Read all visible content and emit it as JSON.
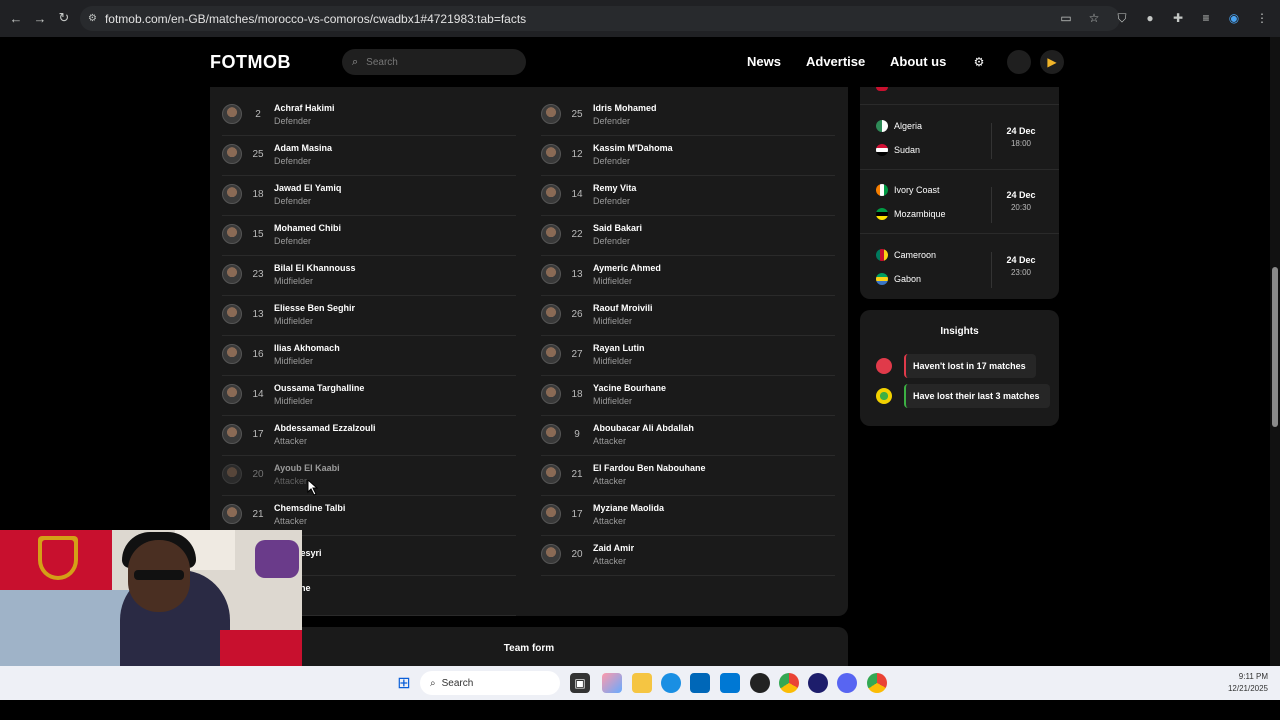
{
  "browser": {
    "url": "fotmob.com/en-GB/matches/morocco-vs-comoros/cwadbx1#4721983:tab=facts"
  },
  "header": {
    "logo": "FOTMOB",
    "search_placeholder": "Search",
    "nav": [
      "News",
      "Advertise",
      "About us"
    ]
  },
  "lineup": {
    "home": [
      {
        "number": "2",
        "name": "Achraf Hakimi",
        "position": "Defender"
      },
      {
        "number": "25",
        "name": "Adam Masina",
        "position": "Defender"
      },
      {
        "number": "18",
        "name": "Jawad El Yamiq",
        "position": "Defender"
      },
      {
        "number": "15",
        "name": "Mohamed Chibi",
        "position": "Defender"
      },
      {
        "number": "23",
        "name": "Bilal El Khannouss",
        "position": "Midfielder"
      },
      {
        "number": "13",
        "name": "Eliesse Ben Seghir",
        "position": "Midfielder"
      },
      {
        "number": "16",
        "name": "Ilias Akhomach",
        "position": "Midfielder"
      },
      {
        "number": "14",
        "name": "Oussama Targhalline",
        "position": "Midfielder"
      },
      {
        "number": "17",
        "name": "Abdessamad Ezzalzouli",
        "position": "Attacker"
      },
      {
        "number": "20",
        "name": "Ayoub El Kaabi",
        "position": "Attacker"
      },
      {
        "number": "21",
        "name": "Chemsdine Talbi",
        "position": "Attacker"
      },
      {
        "number": "",
        "name": "f En-Nesyri",
        "position": ""
      },
      {
        "number": "",
        "name": "lgamane",
        "position": "injury"
      }
    ],
    "away": [
      {
        "number": "25",
        "name": "Idris Mohamed",
        "position": "Defender"
      },
      {
        "number": "12",
        "name": "Kassim M'Dahoma",
        "position": "Defender"
      },
      {
        "number": "14",
        "name": "Remy Vita",
        "position": "Defender"
      },
      {
        "number": "22",
        "name": "Said Bakari",
        "position": "Defender"
      },
      {
        "number": "13",
        "name": "Aymeric Ahmed",
        "position": "Midfielder"
      },
      {
        "number": "26",
        "name": "Raouf Mroivili",
        "position": "Midfielder"
      },
      {
        "number": "27",
        "name": "Rayan Lutin",
        "position": "Midfielder"
      },
      {
        "number": "18",
        "name": "Yacine Bourhane",
        "position": "Midfielder"
      },
      {
        "number": "9",
        "name": "Aboubacar Ali Abdallah",
        "position": "Attacker"
      },
      {
        "number": "21",
        "name": "El Fardou Ben Nabouhane",
        "position": "Attacker"
      },
      {
        "number": "17",
        "name": "Myziane Maolida",
        "position": "Attacker"
      },
      {
        "number": "20",
        "name": "Zaid Amir",
        "position": "Attacker"
      }
    ]
  },
  "team_form": {
    "title": "Team form"
  },
  "fixtures": [
    {
      "home": "Algeria",
      "away": "Sudan",
      "date": "24 Dec",
      "time": "18:00",
      "home_color": "#2e8b57",
      "away_color": "#d21034"
    },
    {
      "home": "Ivory Coast",
      "away": "Mozambique",
      "date": "24 Dec",
      "time": "20:30",
      "home_color": "#f77f00",
      "away_color": "#009a44"
    },
    {
      "home": "Cameroon",
      "away": "Gabon",
      "date": "24 Dec",
      "time": "23:00",
      "home_color": "#c8102e",
      "away_color": "#3a75c4"
    }
  ],
  "insights": {
    "title": "Insights",
    "items": [
      {
        "text": "Haven't lost in 17 matches",
        "color": "#e03a4a"
      },
      {
        "text": "Have lost their last 3 matches",
        "color": "#3cb043"
      }
    ]
  },
  "taskbar": {
    "search": "Search",
    "time": "9:11 PM",
    "date": "12/21/2025"
  }
}
